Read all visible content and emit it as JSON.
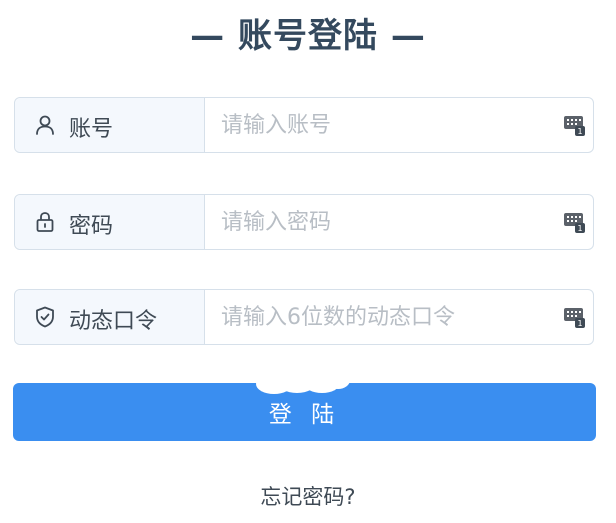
{
  "header": {
    "title": "— 账号登陆 —"
  },
  "fields": [
    {
      "label": "账号",
      "placeholder": "请输入账号"
    },
    {
      "label": "密码",
      "placeholder": "请输入密码"
    },
    {
      "label": "动态口令",
      "placeholder": "请输入6位数的动态口令"
    }
  ],
  "login_button": {
    "label": "登 陆"
  },
  "forgot_link": {
    "label": "忘记密码?"
  },
  "colors": {
    "accent": "#3a8ef0",
    "label_bg": "#f4f8fd",
    "border": "#d6e0ea",
    "text": "#3f4a55",
    "placeholder": "#b8bec5"
  },
  "icons": {
    "account": "user-icon",
    "password": "lock-icon",
    "otp": "shield-check-icon",
    "keyboard": "keyboard-icon"
  }
}
